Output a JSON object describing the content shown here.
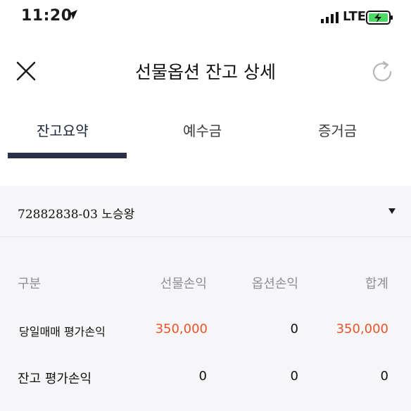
{
  "status_bar": {
    "time": "11:20",
    "network": "LTE"
  },
  "nav": {
    "title": "선물옵션 잔고 상세"
  },
  "tabs": [
    {
      "label": "잔고요약",
      "active": true
    },
    {
      "label": "예수금",
      "active": false
    },
    {
      "label": "증거금",
      "active": false
    }
  ],
  "account": {
    "number": "72882838-03",
    "name": "노승왕"
  },
  "table": {
    "headers": [
      "구분",
      "선물손익",
      "옵션손익",
      "합계"
    ],
    "rows": [
      {
        "label": "당일매매 평가손익",
        "futures": "350,000",
        "options": "0",
        "total": "350,000"
      },
      {
        "label": "잔고 평가손익",
        "futures": "0",
        "options": "0",
        "total": "0"
      }
    ]
  },
  "colors": {
    "accent": "#2b3049",
    "profit": "#e8552a",
    "battery": "#4cd964"
  }
}
